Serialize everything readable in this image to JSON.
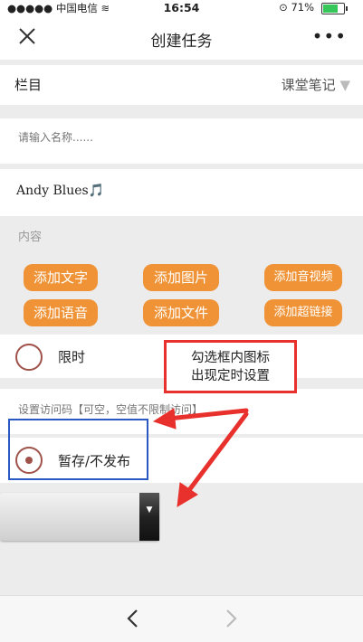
{
  "status": {
    "carrier": "中国电信",
    "time": "16:54",
    "battery": "71%"
  },
  "nav": {
    "title": "创建任务",
    "more": "•••"
  },
  "column": {
    "label": "栏目",
    "value": "课堂笔记"
  },
  "name_input": {
    "placeholder": "请输入名称......"
  },
  "text_value": "Andy Blues🎵",
  "content_label": "内容",
  "buttons": {
    "add_text": "添加文字",
    "add_image": "添加图片",
    "add_av": "添加音视频",
    "add_voice": "添加语音",
    "add_file": "添加文件",
    "add_link": "添加超链接"
  },
  "timed": {
    "label": "限时"
  },
  "callout": {
    "line1": "勾选框内图标",
    "line2": "出现定时设置"
  },
  "access_code": {
    "placeholder": "设置访问码【可空，空值不限制访问】"
  },
  "draft": {
    "label": "暂存/不发布"
  },
  "colors": {
    "accent": "#ef9336",
    "annotation_red": "#e8302c",
    "annotation_blue": "#2b59c3",
    "radio": "#a0524a"
  }
}
